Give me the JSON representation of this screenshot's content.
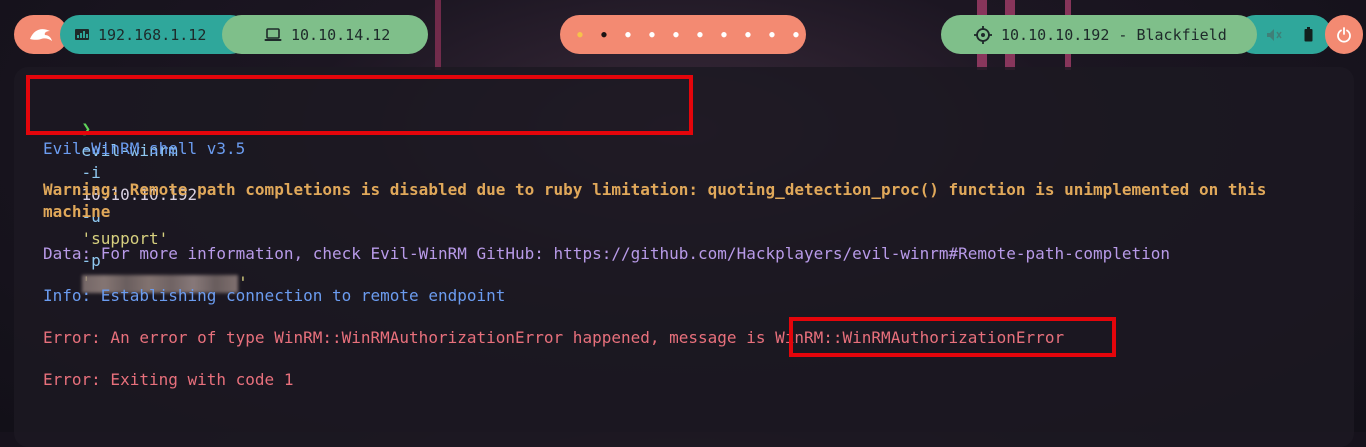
{
  "topbar": {
    "logo_icon": "kali-dragon-icon",
    "local_ip_icon": "network-icon",
    "local_ip": "192.168.1.12",
    "vpn_ip_icon": "laptop-icon",
    "vpn_ip": "10.10.14.12",
    "workspaces_count": 10,
    "active_workspace": 1,
    "target_icon": "crosshair-icon",
    "target": "10.10.10.192 - Blackfield",
    "volume_icon": "volume-mute-icon",
    "battery_icon": "battery-icon",
    "power_icon": "power-icon",
    "colors": {
      "logo_bg": "#f38a72",
      "local_ip_bg": "#2fa79b",
      "vpn_ip_bg": "#7fbf8a",
      "workspaces_bg": "#f38a72",
      "target_bg": "#7fbf8a",
      "tray_bg": "#2fa79b",
      "power_bg": "#f38a72"
    }
  },
  "terminal": {
    "prompt_symbol": "❯",
    "command_name": "evil-winrm",
    "command_flag_i": "-i",
    "command_ip": "10.10.10.192",
    "command_flag_u": "-u",
    "command_user": "'support'",
    "command_flag_p": "-p",
    "command_pass_open": "'",
    "command_pass_close": "'",
    "lines": {
      "version": "Evil-WinRM shell v3.5",
      "warning_1": "Warning: Remote path completions is disabled due to ruby limitation: quoting_detection_proc() function is unimplemented on this",
      "warning_2": "machine",
      "data": "Data: For more information, check Evil-WinRM GitHub: https://github.com/Hackplayers/evil-winrm#Remote-path-completion",
      "info": "Info: Establishing connection to remote endpoint",
      "error_1": "Error: An error of type WinRM::WinRMAuthorizationError happened, message is WinRM::WinRMAuthorizationError",
      "error_2": "Error: Exiting with code 1"
    },
    "colors": {
      "prompt": "#5fd35a",
      "command": "#8fc8f0",
      "flags": "#8fc8f0",
      "string": "#d7d07f",
      "version": "#6b9cf0",
      "warning": "#e0a85a",
      "data": "#b89ae8",
      "info": "#6b9cf0",
      "error": "#e8707c",
      "highlight_box": "#e4050b"
    }
  }
}
